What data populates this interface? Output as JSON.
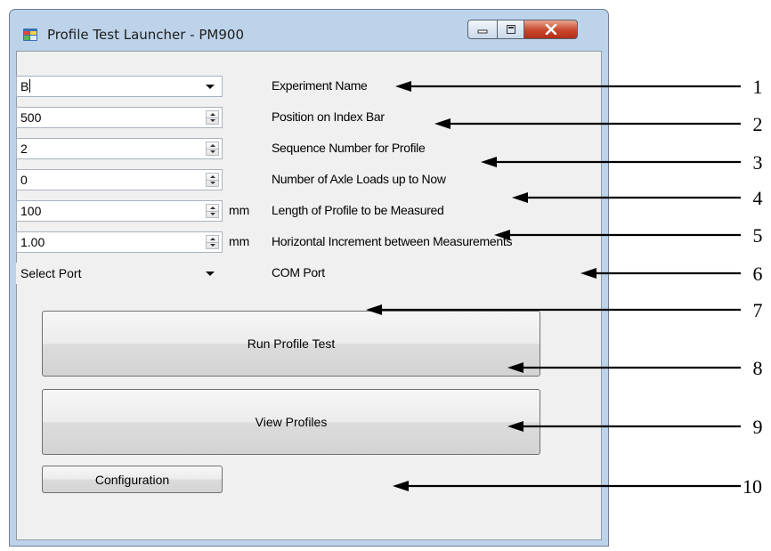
{
  "window": {
    "title": "Profile Test Launcher - PM900",
    "controls": [
      "minimize",
      "maximize",
      "close"
    ]
  },
  "fields": [
    {
      "value": "B",
      "kind": "dropdown",
      "unit": "",
      "label": "Experiment Name"
    },
    {
      "value": "500",
      "kind": "spinner",
      "unit": "",
      "label": "Position on Index Bar"
    },
    {
      "value": "2",
      "kind": "spinner",
      "unit": "",
      "label": "Sequence Number for Profile"
    },
    {
      "value": "0",
      "kind": "spinner",
      "unit": "",
      "label": "Number of Axle Loads up to Now"
    },
    {
      "value": "100",
      "kind": "spinner",
      "unit": "mm",
      "label": "Length of Profile to be Measured"
    },
    {
      "value": "1.00",
      "kind": "spinner",
      "unit": "mm",
      "label": "Horizontal Increment between Measurements"
    },
    {
      "value": "Select Port",
      "kind": "dropdown",
      "unit": "",
      "label": "COM Port"
    }
  ],
  "buttons": {
    "run": "Run Profile Test",
    "view": "View Profiles",
    "config": "Configuration"
  },
  "callouts": [
    "1",
    "2",
    "3",
    "4",
    "5",
    "6",
    "7",
    "8",
    "9",
    "10"
  ]
}
